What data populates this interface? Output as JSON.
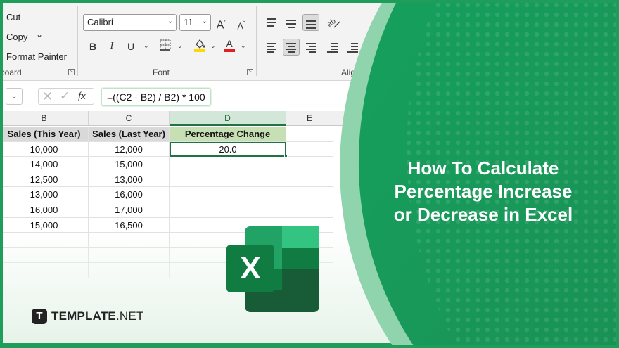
{
  "ribbon": {
    "clipboard": {
      "cut": "Cut",
      "copy": "Copy",
      "copy_caret": "⌄",
      "format_painter": "Format Painter",
      "group_label": "board"
    },
    "font": {
      "name": "Calibri",
      "size": "11",
      "grow": "A",
      "shrink": "A",
      "bold": "B",
      "italic": "I",
      "underline": "U",
      "group_label": "Font",
      "font_color": "#e02020",
      "fill_color": "#ffd800"
    },
    "alignment": {
      "group_label": "Align"
    }
  },
  "formula_bar": {
    "cancel": "✕",
    "enter": "✓",
    "fx": "fx",
    "formula": "=((C2 - B2) / B2) * 100"
  },
  "sheet": {
    "columns": [
      "B",
      "C",
      "D",
      "E"
    ],
    "headers": [
      "Sales (This Year)",
      "Sales (Last Year)",
      "Percentage Change"
    ],
    "rows": [
      [
        "10,000",
        "12,000",
        "20.0"
      ],
      [
        "14,000",
        "15,000",
        ""
      ],
      [
        "12,500",
        "13,000",
        ""
      ],
      [
        "13,000",
        "16,000",
        ""
      ],
      [
        "16,000",
        "17,000",
        ""
      ],
      [
        "15,000",
        "16,500",
        ""
      ]
    ]
  },
  "panel": {
    "title_line1": "How To Calculate",
    "title_line2": "Percentage Increase",
    "title_line3": "or Decrease in Excel",
    "excel_letter": "X"
  },
  "brand": {
    "mark": "T",
    "name_bold": "TEMPLATE",
    "name_light": ".NET"
  },
  "colors": {
    "brand_green": "#1f9d5a",
    "excel_dark": "#185c37",
    "excel_mid": "#21a366",
    "excel_light": "#33c481",
    "excel_badge": "#107c41"
  }
}
